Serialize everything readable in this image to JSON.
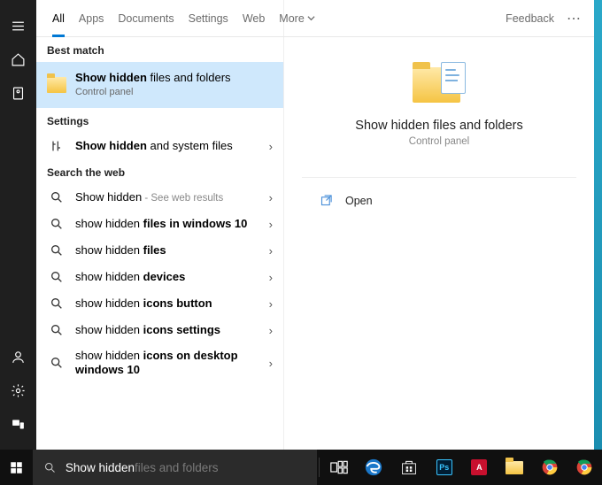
{
  "tabs": {
    "all": "All",
    "apps": "Apps",
    "docs": "Documents",
    "settings": "Settings",
    "web": "Web",
    "more": "More",
    "feedback": "Feedback"
  },
  "sections": {
    "best": "Best match",
    "settings": "Settings",
    "web": "Search the web"
  },
  "best": {
    "pre": "Show hidden",
    "rest": " files and folders",
    "sub": "Control panel"
  },
  "settings_item": {
    "pre": "Show hidden",
    "rest": " and system files"
  },
  "web_items": [
    {
      "pre": "Show hidden",
      "rest": "",
      "suffix": " - See web results"
    },
    {
      "pre": "show hidden ",
      "bold": "files in windows 10"
    },
    {
      "pre": "show hidden ",
      "bold": "files"
    },
    {
      "pre": "show hidden ",
      "bold": "devices"
    },
    {
      "pre": "show hidden ",
      "bold": "icons button"
    },
    {
      "pre": "show hidden ",
      "bold": "icons settings"
    },
    {
      "pre": "show hidden ",
      "bold": "icons on desktop windows 10"
    }
  ],
  "preview": {
    "title": "Show hidden files and folders",
    "sub": "Control panel",
    "open": "Open"
  },
  "search": {
    "typed": "Show hidden",
    "hint": " files and folders"
  }
}
